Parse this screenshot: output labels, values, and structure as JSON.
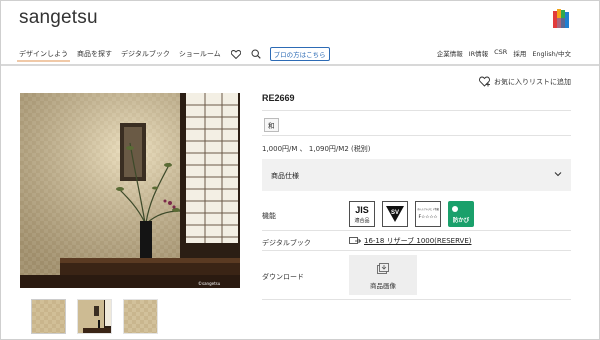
{
  "header": {
    "logo": "sangetsu"
  },
  "nav": {
    "items": [
      "デザインしよう",
      "商品を探す",
      "デジタルブック",
      "ショールーム"
    ],
    "pro_button": "プロの方はこちら",
    "right_links": [
      "企業情報",
      "IR情報",
      "CSR",
      "採用",
      "English/中文"
    ]
  },
  "favorite": {
    "label": "お気に入りリストに追加"
  },
  "product": {
    "code": "RE2669",
    "tag": "和",
    "price": "1,000円/M 、 1,090円/M2 (税別)",
    "spec_label": "商品仕様",
    "function_label": "機能",
    "badges": {
      "jis_top": "JIS",
      "jis_bottom": "適合品",
      "sv_letter": "SV",
      "formaldehyde_top": "ホルムアルデヒド等級",
      "formaldehyde_grade": "F☆☆☆☆",
      "mold_label": "防かび"
    },
    "digital_book_label": "デジタルブック",
    "digital_book_link": "16-18 リザーブ 1000(RESERVE)",
    "download_label": "ダウンロード",
    "download_button": "商品画像"
  },
  "image": {
    "watermark": "©sangetsu"
  },
  "colors": {
    "accent_blue": "#2d6bb5",
    "mold_green": "#1aa06b",
    "nav_active": "#f0c9a8",
    "panel_bg": "#f1f1f1"
  }
}
